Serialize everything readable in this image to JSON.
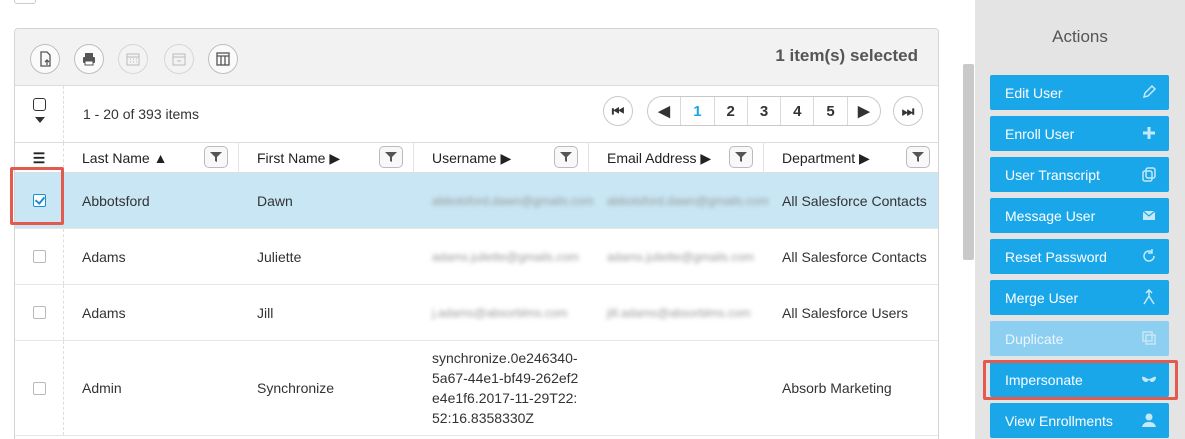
{
  "toolbar": {
    "selected_count": "1 item(s) selected",
    "buttons": [
      "new-export-icon",
      "print-icon",
      "calendar-icon",
      "calendar-alt-icon",
      "columns-icon"
    ]
  },
  "pager": {
    "item_range": "1 - 20 of 393 items",
    "pages": [
      "1",
      "2",
      "3",
      "4",
      "5"
    ],
    "active_page": "1"
  },
  "columns": [
    {
      "label": "Last Name ▲"
    },
    {
      "label": "First Name ▶"
    },
    {
      "label": "Username ▶"
    },
    {
      "label": "Email Address ▶"
    },
    {
      "label": "Department ▶"
    }
  ],
  "rows": [
    {
      "selected": true,
      "last": "Abbotsford",
      "first": "Dawn",
      "username": "abbotsford.dawn@gmails.com",
      "email": "abbotsford.dawn@gmails.com",
      "department": "All Salesforce Contacts"
    },
    {
      "selected": false,
      "last": "Adams",
      "first": "Juliette",
      "username": "adams.juliette@gmails.com",
      "email": "adams.juliette@gmails.com",
      "department": "All Salesforce Contacts"
    },
    {
      "selected": false,
      "last": "Adams",
      "first": "Jill",
      "username": "j.adams@absorblms.com",
      "email": "jill.adams@absorblms.com",
      "department": "All Salesforce Users"
    },
    {
      "selected": false,
      "last": "Admin",
      "first": "Synchronize",
      "username": "synchronize.0e246340-5a67-44e1-bf49-262ef2e4e1f6.2017-11-29T22:52:16.8358330Z",
      "email": "",
      "department": "Absorb Marketing"
    }
  ],
  "actions": {
    "title": "Actions",
    "items": [
      {
        "label": "Edit User",
        "icon": "pencil-icon"
      },
      {
        "label": "Enroll User",
        "icon": "plus-icon"
      },
      {
        "label": "User Transcript",
        "icon": "copy-icon"
      },
      {
        "label": "Message User",
        "icon": "envelope-icon"
      },
      {
        "label": "Reset Password",
        "icon": "refresh-icon"
      },
      {
        "label": "Merge User",
        "icon": "merge-icon"
      },
      {
        "label": "Duplicate",
        "icon": "duplicate-icon",
        "disabled": true
      },
      {
        "label": "Impersonate",
        "icon": "mask-icon"
      },
      {
        "label": "View Enrollments",
        "icon": "user-icon"
      }
    ]
  },
  "colors": {
    "accent": "#1aa7ea",
    "selected_row": "#c8e6f4",
    "highlight": "#e35a4f",
    "panel_bg": "#e4e4e4"
  }
}
